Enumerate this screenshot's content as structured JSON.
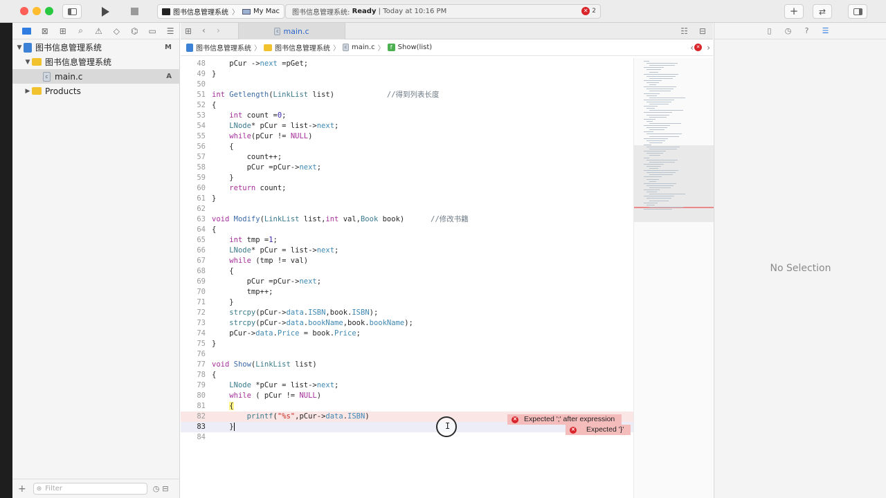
{
  "toolbar": {
    "scheme_project": "图书信息管理系统",
    "scheme_separator": "〉",
    "scheme_device": "My Mac",
    "status_project": "图书信息管理系统:",
    "status_state": "Ready",
    "status_divider": "|",
    "status_time": "Today at 10:16 PM",
    "error_count": "2"
  },
  "navigator": {
    "project": "图书信息管理系统",
    "project_badge": "M",
    "group": "图书信息管理系统",
    "file": "main.c",
    "file_badge": "A",
    "products": "Products",
    "filter_placeholder": "Filter"
  },
  "editor": {
    "tab_label": "main.c",
    "jumpbar": {
      "project": "图书信息管理系统",
      "group": "图书信息管理系统",
      "file": "main.c",
      "function": "Show(list)"
    },
    "errors": {
      "line82": "Expected ';' after expression",
      "line83": "Expected '}'"
    },
    "cursor_glyph": "I"
  },
  "inspector": {
    "empty_text": "No Selection"
  },
  "code_lines": [
    {
      "n": 48,
      "segs": [
        [
          "",
          "    pCur ->"
        ],
        [
          "mem",
          "next"
        ],
        [
          "",
          " =pGet;"
        ]
      ]
    },
    {
      "n": 49,
      "segs": [
        [
          "",
          "}"
        ]
      ]
    },
    {
      "n": 50,
      "segs": []
    },
    {
      "n": 51,
      "segs": [
        [
          "kw",
          "int"
        ],
        [
          "",
          " "
        ],
        [
          "fn",
          "Getlength"
        ],
        [
          "",
          "("
        ],
        [
          "ty",
          "LinkList"
        ],
        [
          "",
          " list)            "
        ],
        [
          "cm",
          "//得到列表长度"
        ]
      ]
    },
    {
      "n": 52,
      "segs": [
        [
          "",
          "{"
        ]
      ]
    },
    {
      "n": 53,
      "segs": [
        [
          "",
          "    "
        ],
        [
          "kw",
          "int"
        ],
        [
          "",
          " count ="
        ],
        [
          "num",
          "0"
        ],
        [
          "",
          ";"
        ]
      ]
    },
    {
      "n": 54,
      "segs": [
        [
          "",
          "    "
        ],
        [
          "ty",
          "LNode"
        ],
        [
          "",
          "* pCur = list->"
        ],
        [
          "mem",
          "next"
        ],
        [
          "",
          ";"
        ]
      ]
    },
    {
      "n": 55,
      "segs": [
        [
          "",
          "    "
        ],
        [
          "kw",
          "while"
        ],
        [
          "",
          "(pCur != "
        ],
        [
          "kw",
          "NULL"
        ],
        [
          "",
          ")"
        ]
      ]
    },
    {
      "n": 56,
      "segs": [
        [
          "",
          "    {"
        ]
      ]
    },
    {
      "n": 57,
      "segs": [
        [
          "",
          "        count++;"
        ]
      ]
    },
    {
      "n": 58,
      "segs": [
        [
          "",
          "        pCur =pCur->"
        ],
        [
          "mem",
          "next"
        ],
        [
          "",
          ";"
        ]
      ]
    },
    {
      "n": 59,
      "segs": [
        [
          "",
          "    }"
        ]
      ]
    },
    {
      "n": 60,
      "segs": [
        [
          "",
          "    "
        ],
        [
          "kw",
          "return"
        ],
        [
          "",
          " count;"
        ]
      ]
    },
    {
      "n": 61,
      "segs": [
        [
          "",
          "}"
        ]
      ]
    },
    {
      "n": 62,
      "segs": []
    },
    {
      "n": 63,
      "segs": [
        [
          "kw",
          "void"
        ],
        [
          "",
          " "
        ],
        [
          "fn",
          "Modify"
        ],
        [
          "",
          "("
        ],
        [
          "ty",
          "LinkList"
        ],
        [
          "",
          " list,"
        ],
        [
          "kw",
          "int"
        ],
        [
          "",
          " val,"
        ],
        [
          "ty",
          "Book"
        ],
        [
          "",
          " book)      "
        ],
        [
          "cm",
          "//修改书籍"
        ]
      ]
    },
    {
      "n": 64,
      "segs": [
        [
          "",
          "{"
        ]
      ]
    },
    {
      "n": 65,
      "segs": [
        [
          "",
          "    "
        ],
        [
          "kw",
          "int"
        ],
        [
          "",
          " tmp ="
        ],
        [
          "num",
          "1"
        ],
        [
          "",
          ";"
        ]
      ]
    },
    {
      "n": 66,
      "segs": [
        [
          "",
          "    "
        ],
        [
          "ty",
          "LNode"
        ],
        [
          "",
          "* pCur = list->"
        ],
        [
          "mem",
          "next"
        ],
        [
          "",
          ";"
        ]
      ]
    },
    {
      "n": 67,
      "segs": [
        [
          "",
          "    "
        ],
        [
          "kw",
          "while"
        ],
        [
          "",
          " (tmp != val)"
        ]
      ]
    },
    {
      "n": 68,
      "segs": [
        [
          "",
          "    {"
        ]
      ]
    },
    {
      "n": 69,
      "segs": [
        [
          "",
          "        pCur =pCur->"
        ],
        [
          "mem",
          "next"
        ],
        [
          "",
          ";"
        ]
      ]
    },
    {
      "n": 70,
      "segs": [
        [
          "",
          "        tmp++;"
        ]
      ]
    },
    {
      "n": 71,
      "segs": [
        [
          "",
          "    }"
        ]
      ]
    },
    {
      "n": 72,
      "segs": [
        [
          "",
          "    "
        ],
        [
          "ty",
          "strcpy"
        ],
        [
          "",
          "(pCur->"
        ],
        [
          "mem",
          "data"
        ],
        [
          "",
          "."
        ],
        [
          "mem",
          "ISBN"
        ],
        [
          "",
          ",book."
        ],
        [
          "mem",
          "ISBN"
        ],
        [
          "",
          ");"
        ]
      ]
    },
    {
      "n": 73,
      "segs": [
        [
          "",
          "    "
        ],
        [
          "ty",
          "strcpy"
        ],
        [
          "",
          "(pCur->"
        ],
        [
          "mem",
          "data"
        ],
        [
          "",
          "."
        ],
        [
          "mem",
          "bookName"
        ],
        [
          "",
          ",book."
        ],
        [
          "mem",
          "bookName"
        ],
        [
          "",
          ");"
        ]
      ]
    },
    {
      "n": 74,
      "segs": [
        [
          "",
          "    pCur->"
        ],
        [
          "mem",
          "data"
        ],
        [
          "",
          "."
        ],
        [
          "mem",
          "Price"
        ],
        [
          "",
          " = book."
        ],
        [
          "mem",
          "Price"
        ],
        [
          "",
          ";"
        ]
      ]
    },
    {
      "n": 75,
      "segs": [
        [
          "",
          "}"
        ]
      ]
    },
    {
      "n": 76,
      "segs": []
    },
    {
      "n": 77,
      "segs": [
        [
          "kw",
          "void"
        ],
        [
          "",
          " "
        ],
        [
          "fn",
          "Show"
        ],
        [
          "",
          "("
        ],
        [
          "ty",
          "LinkList"
        ],
        [
          "",
          " list)"
        ]
      ]
    },
    {
      "n": 78,
      "segs": [
        [
          "",
          "{"
        ]
      ]
    },
    {
      "n": 79,
      "segs": [
        [
          "",
          "    "
        ],
        [
          "ty",
          "LNode"
        ],
        [
          "",
          " *pCur = list->"
        ],
        [
          "mem",
          "next"
        ],
        [
          "",
          ";"
        ]
      ]
    },
    {
      "n": 80,
      "segs": [
        [
          "",
          "    "
        ],
        [
          "kw",
          "while"
        ],
        [
          "",
          " ( pCur != "
        ],
        [
          "kw",
          "NULL"
        ],
        [
          "",
          ")"
        ]
      ]
    },
    {
      "n": 81,
      "segs": [
        [
          "",
          "    "
        ],
        [
          "hl",
          "{"
        ]
      ]
    },
    {
      "n": 82,
      "segs": [
        [
          "",
          "        "
        ],
        [
          "ty",
          "printf"
        ],
        [
          "",
          "("
        ],
        [
          "str",
          "\"%s\""
        ],
        [
          "",
          ",pCur->"
        ],
        [
          "mem",
          "data"
        ],
        [
          "",
          "."
        ],
        [
          "mem",
          "ISBN"
        ],
        [
          "",
          ")"
        ]
      ],
      "state": "err"
    },
    {
      "n": 83,
      "segs": [
        [
          "",
          "    }"
        ]
      ],
      "state": "cur"
    },
    {
      "n": 84,
      "segs": []
    }
  ],
  "colors": {
    "error_red": "#d9252a",
    "error_line_bg": "#fbe6e6",
    "error_msg_bg": "#f5bcbc",
    "current_line_bg": "#ecedf7",
    "tab_active_text": "#2a64c9"
  }
}
